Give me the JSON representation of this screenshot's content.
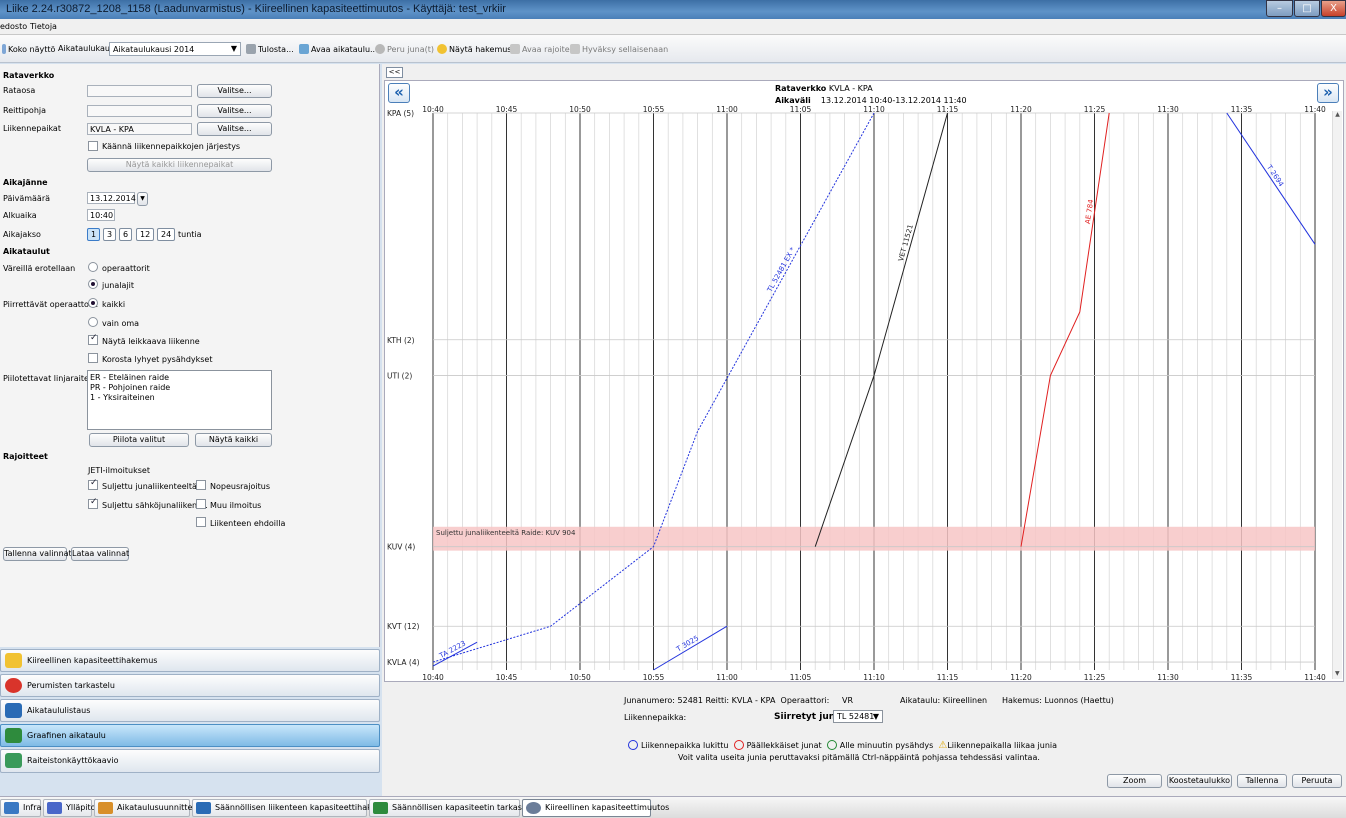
{
  "window": {
    "title": "Liike 2.24.r30872_1208_1158 (Laadunvarmistus) - Kiireellinen kapasiteettimuutos - Käyttäjä: test_vrkiir",
    "minimize": "–",
    "maximize": "□",
    "close": "X"
  },
  "menu": [
    "edosto",
    "Tietoja"
  ],
  "toolbar": {
    "fullscreen": "Koko näyttö",
    "timetable_period_label": "Aikataulukausi",
    "timetable_period_value": "Aikataulukausi 2014",
    "print": "Tulosta...",
    "open_timetable": "Avaa aikataulu...",
    "cancel_train": "Peru juna(t)",
    "show_application": "Näytä hakemus",
    "open_restrictions": "Avaa rajoite",
    "accept_as_is": "Hyväksy sellaisenaan"
  },
  "left": {
    "rataverkko_header": "Rataverkko",
    "rataosa_label": "Rataosa",
    "rataosa_value": "",
    "reittipohja_label": "Reittipohja",
    "reittipohja_value": "",
    "liikennepaikat_label": "Liikennepaikat",
    "liikennepaikat_value": "KVLA - KPA",
    "choose": "Valitse...",
    "reverse_label": "Käännä liikennepaikkojen järjestys",
    "show_all_places": "Näytä kaikki liikennepaikat",
    "aikajanne_header": "Aikajänne",
    "date_label": "Päivämäärä",
    "date_value": "13.12.2014",
    "start_label": "Alkuaika",
    "start_value": "10:40",
    "period_label": "Aikajakso",
    "period_options": [
      "1",
      "3",
      "6",
      "12",
      "24"
    ],
    "period_selected": "1",
    "period_unit": "tuntia",
    "aikataulut_header": "Aikataulut",
    "colors_label": "Väreillä erotellaan",
    "colors_opt1": "operaattorit",
    "colors_opt2": "junalajit",
    "drawn_ops_label": "Piirrettävät operaattorit",
    "drawn_opt1": "kaikki",
    "drawn_opt2": "vain oma",
    "show_cutting": "Näytä leikkaava liikenne",
    "highlight_stops": "Korosta lyhyet pysähdykset",
    "hidden_tracks_label": "Piilotettavat linjaraiteet",
    "tracks": [
      "ER - Eteläinen raide",
      "PR - Pohjoinen raide",
      "1 - Yksiraiteinen"
    ],
    "hide_selected": "Piilota valitut",
    "show_all": "Näytä kaikki",
    "rajoitteet_header": "Rajoitteet",
    "jeti_label": "JETI-ilmoitukset",
    "closed_train": "Suljettu junaliikenteeltä",
    "closed_electric": "Suljettu sähköjunaliikent...",
    "speed_restriction": "Nopeusrajoitus",
    "other_notice": "Muu ilmoitus",
    "traffic_conditions": "Liikenteen ehdoilla",
    "save_selections": "Tallenna valinnat",
    "load_selections": "Lataa valinnat"
  },
  "nav": [
    {
      "label": "Kiireellinen kapasiteettihakemus",
      "color": "#f1c232",
      "active": false
    },
    {
      "label": "Perumisten tarkastelu",
      "color": "#d9342b",
      "active": false
    },
    {
      "label": "Aikataululistaus",
      "color": "#2a6bb5",
      "active": false
    },
    {
      "label": "Graafinen aikataulu",
      "color": "#2e8b3d",
      "active": true
    },
    {
      "label": "Raiteistonkäyttökaavio",
      "color": "#3a9a5a",
      "active": false
    }
  ],
  "chart_header": {
    "network_label": "Rataverkko",
    "network_value": "KVLA - KPA",
    "interval_label": "Aikaväli",
    "interval_value": "13.12.2014 10:40-13.12.2014 11:40",
    "collapse": "<<",
    "prev": "«",
    "next": "»"
  },
  "chart_data": {
    "type": "line",
    "x_ticks": [
      "10:40",
      "10:45",
      "10:50",
      "10:55",
      "11:00",
      "11:05",
      "11:10",
      "11:15",
      "11:20",
      "11:25",
      "11:30",
      "11:35",
      "11:40"
    ],
    "xlim": [
      "10:40",
      "11:40"
    ],
    "stations": [
      {
        "name": "KPA (5)",
        "km": 0
      },
      {
        "name": "KTH (2)",
        "km": 57
      },
      {
        "name": "UTI (2)",
        "km": 66
      },
      {
        "name": "KUV (4)",
        "km": 109
      },
      {
        "name": "KVT (12)",
        "km": 129
      },
      {
        "name": "KVLA (4)",
        "km": 138
      }
    ],
    "restriction": {
      "label": "Suljettu junaliikenteeltä Raide: KUV 904",
      "from_km": 104,
      "to_km": 110,
      "color": "#f7c6c6"
    },
    "series": [
      {
        "name": "TL 52481 EX *",
        "color": "#2233dd",
        "dash": true,
        "points": [
          [
            "10:40",
            138
          ],
          [
            "10:48",
            129
          ],
          [
            "10:55",
            109
          ],
          [
            "10:58",
            80
          ],
          [
            "11:10",
            0
          ]
        ]
      },
      {
        "name": "VET 11521",
        "color": "#222222",
        "dash": false,
        "points": [
          [
            "11:06",
            109
          ],
          [
            "11:10",
            66
          ],
          [
            "11:15",
            0
          ]
        ]
      },
      {
        "name": "AE 784",
        "color": "#e02020",
        "dash": false,
        "points": [
          [
            "11:20",
            109
          ],
          [
            "11:22",
            66
          ],
          [
            "11:24",
            50
          ],
          [
            "11:26",
            0
          ]
        ]
      },
      {
        "name": "TA 2223",
        "color": "#2233dd",
        "dash": false,
        "points": [
          [
            "10:40",
            139
          ],
          [
            "10:43",
            133
          ]
        ]
      },
      {
        "name": "T 3025",
        "color": "#2233dd",
        "dash": false,
        "points": [
          [
            "10:55",
            140
          ],
          [
            "11:00",
            129
          ]
        ]
      },
      {
        "name": "T 2694",
        "color": "#2233dd",
        "dash": false,
        "points": [
          [
            "11:34",
            0
          ],
          [
            "11:40",
            33
          ]
        ]
      }
    ]
  },
  "info": {
    "train_number": "Junanumero:",
    "train_number_value": "52481",
    "route_label": "Reitti:",
    "route_value": "KVLA - KPA",
    "operator_label": "Operaattori:",
    "operator_value": "VR",
    "timetable_label": "Aikataulu: Kiireellinen",
    "application_label": "Hakemus: Luonnos (Haettu)",
    "place_label": "Liikennepaikka:",
    "moved_trains_label": "Siirretyt junat",
    "moved_trains_value": "TL 52481"
  },
  "legend": {
    "locked": "Liikennepaikka lukittu",
    "overlapping": "Päällekkäiset junat",
    "short_stops": "Alle minuutin pysähdys",
    "too_many": "Liikennepaikalla liikaa junia",
    "hint": "Voit valita useita junia peruttavaksi pitämällä Ctrl-näppäintä pohjassa tehdessäsi valintaa."
  },
  "actions": {
    "zoom": "Zoom",
    "summary": "Koostetaulukko",
    "save": "Tallenna",
    "cancel": "Peruuta"
  },
  "taskbar": [
    {
      "label": "Infra",
      "color": "#3a78c3"
    },
    {
      "label": "Ylläpito",
      "color": "#4a67c9"
    },
    {
      "label": "Aikataulusuunnittelu",
      "color": "#d88f2a"
    },
    {
      "label": "Säännöllisen liikenteen kapasiteettihakemus",
      "color": "#2a6bb5"
    },
    {
      "label": "Säännöllisen kapasiteetin tarkastelu",
      "color": "#2e8b3d"
    },
    {
      "label": "Kiireellinen kapasiteettimuutos",
      "color": "#6b7d99"
    }
  ]
}
